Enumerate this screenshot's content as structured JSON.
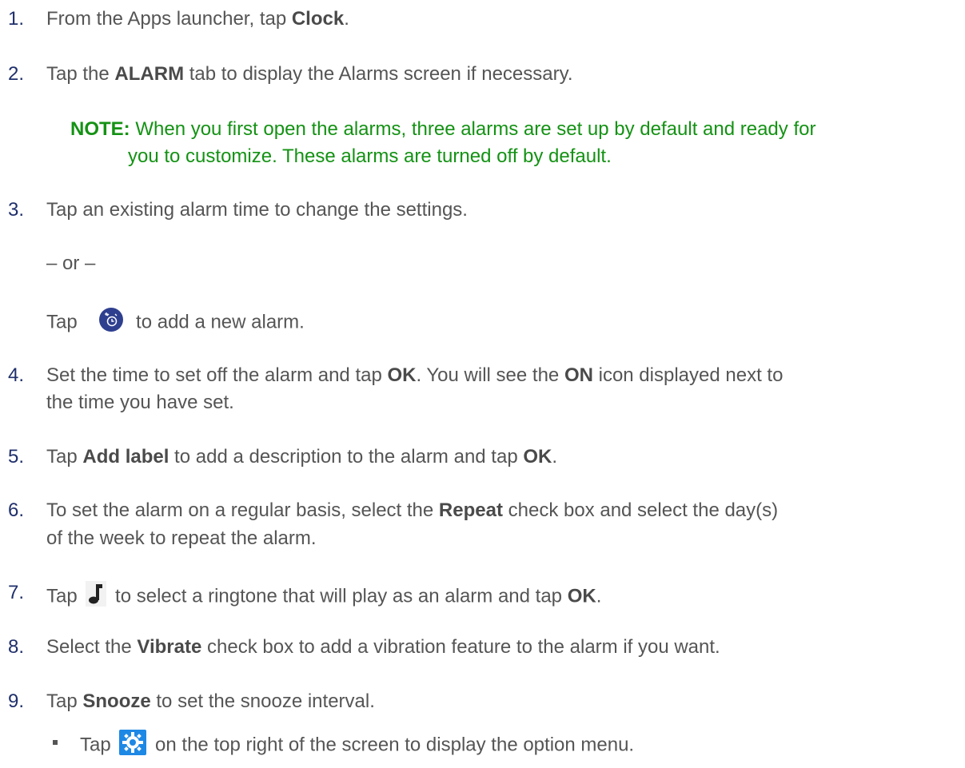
{
  "steps": [
    {
      "num": "1.",
      "pre": "From the Apps launcher, tap ",
      "b1": "Clock",
      "post": "."
    },
    {
      "num": "2.",
      "pre": "Tap the ",
      "b1": "ALARM",
      "post": " tab to display the Alarms screen if necessary."
    },
    {
      "num": "3.",
      "text": "Tap an existing alarm time to change the settings."
    },
    {
      "num": "4.",
      "pre": "Set the time to set off the alarm and tap ",
      "b1": "OK",
      "mid": ". You will see the ",
      "b2": "ON",
      "post": " icon displayed next to",
      "line2": "the time you have set."
    },
    {
      "num": "5.",
      "pre": "Tap ",
      "b1": "Add label",
      "mid": " to add a description to the alarm and tap ",
      "b2": "OK",
      "post": "."
    },
    {
      "num": "6.",
      "pre": "To set the alarm on a regular basis, select the ",
      "b1": "Repeat",
      "post": " check box and select the day(s)",
      "line2": "of the week to repeat the alarm."
    },
    {
      "num": "7.",
      "pre": "Tap ",
      "post": " to select a ringtone that will play as an alarm and tap ",
      "b1": "OK",
      "end": "."
    },
    {
      "num": "8.",
      "pre": "Select the ",
      "b1": "Vibrate",
      "post": " check box to add a vibration feature to the alarm if you want."
    },
    {
      "num": "9.",
      "pre": "Tap ",
      "b1": "Snooze",
      "post": " to set the snooze interval."
    }
  ],
  "note": {
    "label": "NOTE:",
    "line1": " When you first open the alarms, three alarms are set up by default and ready for",
    "line2": "you to customize. These alarms are turned off by default."
  },
  "or_text": "– or –",
  "add_alarm": {
    "pre": "Tap ",
    "post": " to add a new alarm."
  },
  "sub_bullet": {
    "pre": "Tap ",
    "post": " on the top right of the screen to display the option menu."
  },
  "colors": {
    "step_number": "#1f2f6b",
    "note": "#149214",
    "alarm_icon_bg": "#2f3f8f",
    "settings_icon": "#1e88e5"
  },
  "icons": [
    "add-alarm-icon",
    "music-note-icon",
    "settings-gear-icon"
  ]
}
